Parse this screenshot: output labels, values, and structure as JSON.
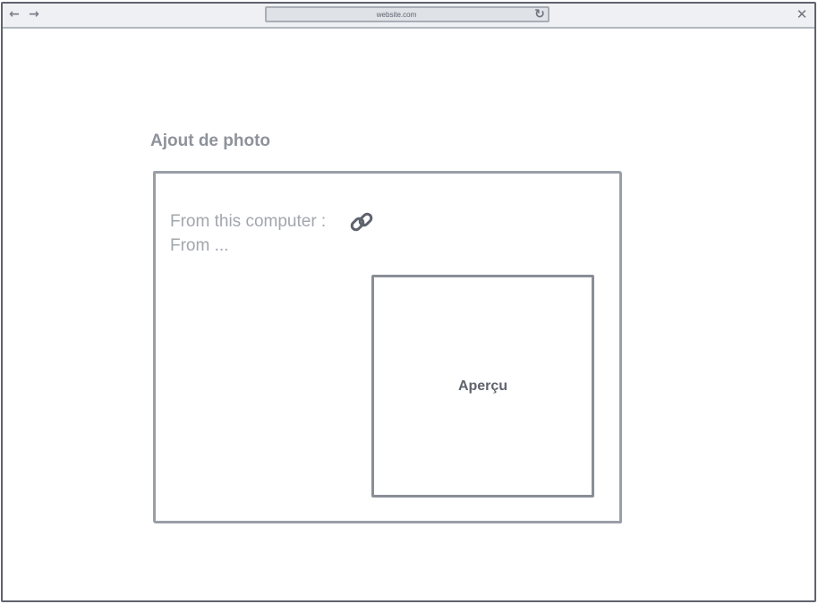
{
  "browser": {
    "url": "website.com",
    "icons": {
      "back": "back-arrow-icon",
      "forward": "forward-arrow-icon",
      "reload": "reload-icon",
      "close": "close-icon"
    }
  },
  "page": {
    "title": "Ajout de photo"
  },
  "upload": {
    "from_computer_label": "From this computer :",
    "link_icon": "link-icon",
    "from_other_label": "From ..."
  },
  "preview": {
    "label": "Aperçu"
  }
}
